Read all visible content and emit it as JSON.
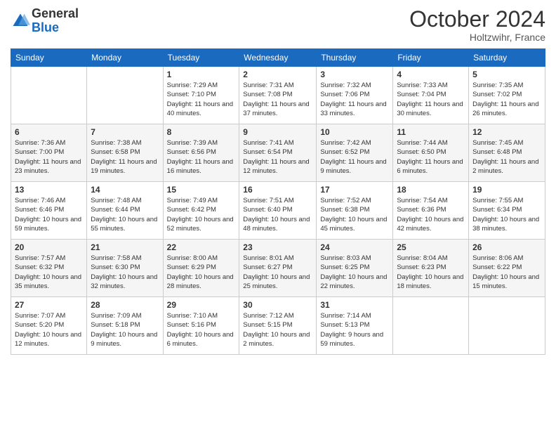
{
  "logo": {
    "general": "General",
    "blue": "Blue"
  },
  "title": "October 2024",
  "location": "Holtzwihr, France",
  "days_of_week": [
    "Sunday",
    "Monday",
    "Tuesday",
    "Wednesday",
    "Thursday",
    "Friday",
    "Saturday"
  ],
  "weeks": [
    [
      {
        "day": "",
        "content": ""
      },
      {
        "day": "",
        "content": ""
      },
      {
        "day": "1",
        "content": "Sunrise: 7:29 AM\nSunset: 7:10 PM\nDaylight: 11 hours and 40 minutes."
      },
      {
        "day": "2",
        "content": "Sunrise: 7:31 AM\nSunset: 7:08 PM\nDaylight: 11 hours and 37 minutes."
      },
      {
        "day": "3",
        "content": "Sunrise: 7:32 AM\nSunset: 7:06 PM\nDaylight: 11 hours and 33 minutes."
      },
      {
        "day": "4",
        "content": "Sunrise: 7:33 AM\nSunset: 7:04 PM\nDaylight: 11 hours and 30 minutes."
      },
      {
        "day": "5",
        "content": "Sunrise: 7:35 AM\nSunset: 7:02 PM\nDaylight: 11 hours and 26 minutes."
      }
    ],
    [
      {
        "day": "6",
        "content": "Sunrise: 7:36 AM\nSunset: 7:00 PM\nDaylight: 11 hours and 23 minutes."
      },
      {
        "day": "7",
        "content": "Sunrise: 7:38 AM\nSunset: 6:58 PM\nDaylight: 11 hours and 19 minutes."
      },
      {
        "day": "8",
        "content": "Sunrise: 7:39 AM\nSunset: 6:56 PM\nDaylight: 11 hours and 16 minutes."
      },
      {
        "day": "9",
        "content": "Sunrise: 7:41 AM\nSunset: 6:54 PM\nDaylight: 11 hours and 12 minutes."
      },
      {
        "day": "10",
        "content": "Sunrise: 7:42 AM\nSunset: 6:52 PM\nDaylight: 11 hours and 9 minutes."
      },
      {
        "day": "11",
        "content": "Sunrise: 7:44 AM\nSunset: 6:50 PM\nDaylight: 11 hours and 6 minutes."
      },
      {
        "day": "12",
        "content": "Sunrise: 7:45 AM\nSunset: 6:48 PM\nDaylight: 11 hours and 2 minutes."
      }
    ],
    [
      {
        "day": "13",
        "content": "Sunrise: 7:46 AM\nSunset: 6:46 PM\nDaylight: 10 hours and 59 minutes."
      },
      {
        "day": "14",
        "content": "Sunrise: 7:48 AM\nSunset: 6:44 PM\nDaylight: 10 hours and 55 minutes."
      },
      {
        "day": "15",
        "content": "Sunrise: 7:49 AM\nSunset: 6:42 PM\nDaylight: 10 hours and 52 minutes."
      },
      {
        "day": "16",
        "content": "Sunrise: 7:51 AM\nSunset: 6:40 PM\nDaylight: 10 hours and 48 minutes."
      },
      {
        "day": "17",
        "content": "Sunrise: 7:52 AM\nSunset: 6:38 PM\nDaylight: 10 hours and 45 minutes."
      },
      {
        "day": "18",
        "content": "Sunrise: 7:54 AM\nSunset: 6:36 PM\nDaylight: 10 hours and 42 minutes."
      },
      {
        "day": "19",
        "content": "Sunrise: 7:55 AM\nSunset: 6:34 PM\nDaylight: 10 hours and 38 minutes."
      }
    ],
    [
      {
        "day": "20",
        "content": "Sunrise: 7:57 AM\nSunset: 6:32 PM\nDaylight: 10 hours and 35 minutes."
      },
      {
        "day": "21",
        "content": "Sunrise: 7:58 AM\nSunset: 6:30 PM\nDaylight: 10 hours and 32 minutes."
      },
      {
        "day": "22",
        "content": "Sunrise: 8:00 AM\nSunset: 6:29 PM\nDaylight: 10 hours and 28 minutes."
      },
      {
        "day": "23",
        "content": "Sunrise: 8:01 AM\nSunset: 6:27 PM\nDaylight: 10 hours and 25 minutes."
      },
      {
        "day": "24",
        "content": "Sunrise: 8:03 AM\nSunset: 6:25 PM\nDaylight: 10 hours and 22 minutes."
      },
      {
        "day": "25",
        "content": "Sunrise: 8:04 AM\nSunset: 6:23 PM\nDaylight: 10 hours and 18 minutes."
      },
      {
        "day": "26",
        "content": "Sunrise: 8:06 AM\nSunset: 6:22 PM\nDaylight: 10 hours and 15 minutes."
      }
    ],
    [
      {
        "day": "27",
        "content": "Sunrise: 7:07 AM\nSunset: 5:20 PM\nDaylight: 10 hours and 12 minutes."
      },
      {
        "day": "28",
        "content": "Sunrise: 7:09 AM\nSunset: 5:18 PM\nDaylight: 10 hours and 9 minutes."
      },
      {
        "day": "29",
        "content": "Sunrise: 7:10 AM\nSunset: 5:16 PM\nDaylight: 10 hours and 6 minutes."
      },
      {
        "day": "30",
        "content": "Sunrise: 7:12 AM\nSunset: 5:15 PM\nDaylight: 10 hours and 2 minutes."
      },
      {
        "day": "31",
        "content": "Sunrise: 7:14 AM\nSunset: 5:13 PM\nDaylight: 9 hours and 59 minutes."
      },
      {
        "day": "",
        "content": ""
      },
      {
        "day": "",
        "content": ""
      }
    ]
  ]
}
